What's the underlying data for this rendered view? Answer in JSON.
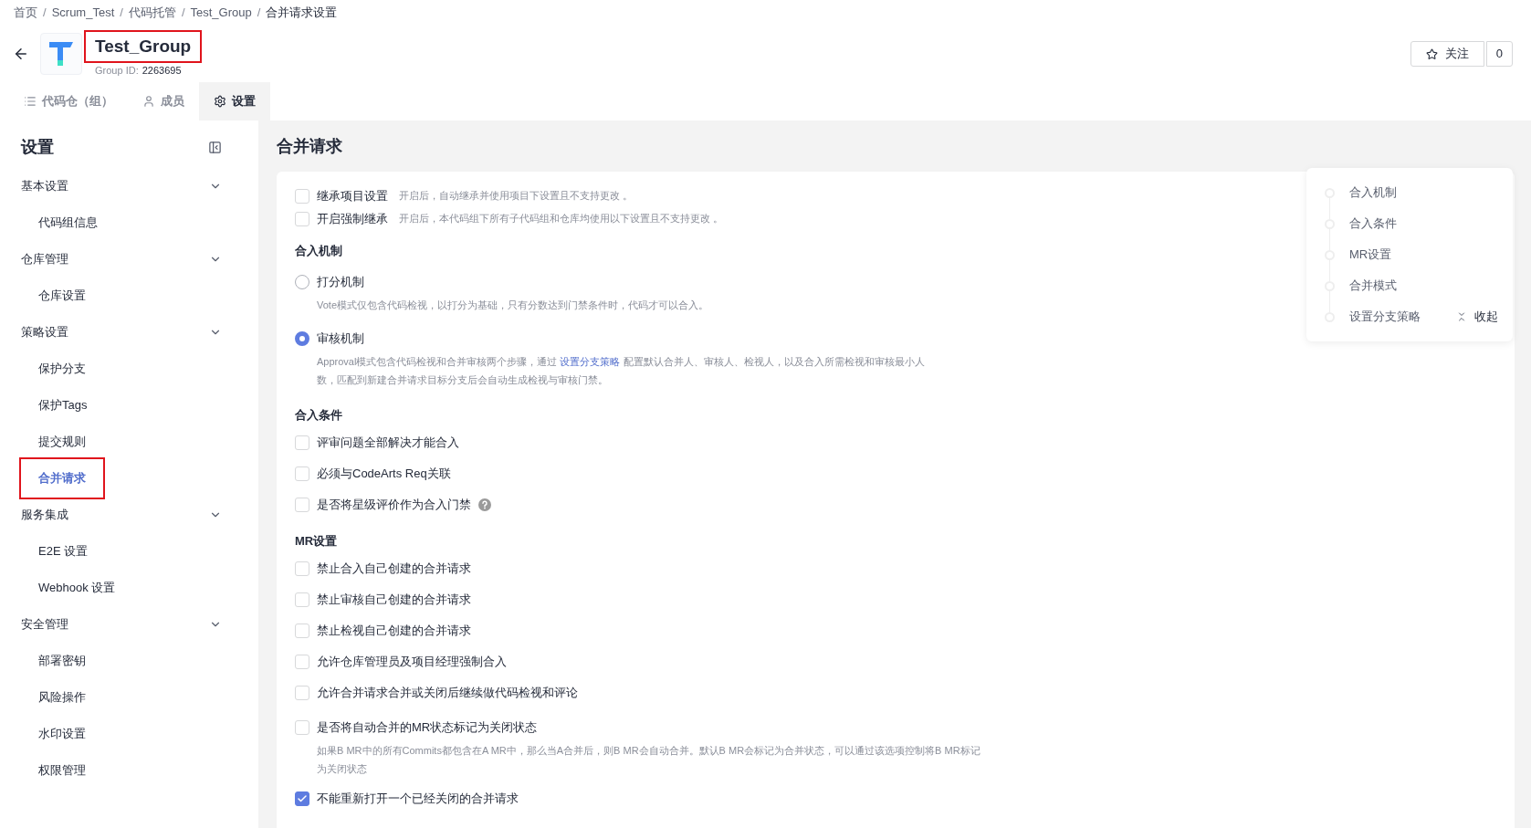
{
  "breadcrumb": [
    "首页",
    "Scrum_Test",
    "代码托管",
    "Test_Group",
    "合并请求设置"
  ],
  "breadcrumb_separator": "/",
  "header": {
    "title": "Test_Group",
    "highlighted": true,
    "group_id_label": "Group ID:",
    "group_id": "2263695"
  },
  "follow": {
    "label": "关注",
    "count": "0"
  },
  "tabs": [
    {
      "label": "代码仓（组）",
      "selected": false
    },
    {
      "label": "成员",
      "selected": false
    },
    {
      "label": "设置",
      "selected": true
    }
  ],
  "sidebar": {
    "title": "设置",
    "groups": [
      {
        "label": "基本设置",
        "expanded": true,
        "children": [
          {
            "label": "代码组信息",
            "selected": false,
            "highlighted": false
          }
        ]
      },
      {
        "label": "仓库管理",
        "expanded": true,
        "children": [
          {
            "label": "仓库设置",
            "selected": false,
            "highlighted": false
          }
        ]
      },
      {
        "label": "策略设置",
        "expanded": true,
        "children": [
          {
            "label": "保护分支",
            "selected": false,
            "highlighted": false
          },
          {
            "label": "保护Tags",
            "selected": false,
            "highlighted": false
          },
          {
            "label": "提交规则",
            "selected": false,
            "highlighted": false
          },
          {
            "label": "合并请求",
            "selected": true,
            "highlighted": true
          }
        ]
      },
      {
        "label": "服务集成",
        "expanded": true,
        "children": [
          {
            "label": "E2E 设置",
            "selected": false,
            "highlighted": false
          },
          {
            "label": "Webhook 设置",
            "selected": false,
            "highlighted": false
          }
        ]
      },
      {
        "label": "安全管理",
        "expanded": true,
        "children": [
          {
            "label": "部署密钥",
            "selected": false,
            "highlighted": false
          },
          {
            "label": "风险操作",
            "selected": false,
            "highlighted": false
          },
          {
            "label": "水印设置",
            "selected": false,
            "highlighted": false
          },
          {
            "label": "权限管理",
            "selected": false,
            "highlighted": false
          }
        ]
      }
    ]
  },
  "page_title": "合并请求",
  "inherit_options": [
    {
      "label": "继承项目设置",
      "hint": "开启后，自动继承并使用项目下设置且不支持更改 。",
      "checked": false
    },
    {
      "label": "开启强制继承",
      "hint": "开启后，本代码组下所有子代码组和仓库均使用以下设置且不支持更改 。",
      "checked": false
    }
  ],
  "sections": [
    {
      "title": "合入机制",
      "items": [
        {
          "kind": "radio",
          "label": "打分机制",
          "selected": false,
          "description": "Vote模式仅包含代码检视，以打分为基础，只有分数达到门禁条件时，代码才可以合入。"
        },
        {
          "kind": "radio",
          "label": "审核机制",
          "selected": true,
          "description_before": "Approval模式包含代码检视和合并审核两个步骤，通过 ",
          "link": "设置分支策略",
          "description_after": " 配置默认合并人、审核人、检视人，以及合入所需检视和审核最小人数，匹配到新建合并请求目标分支后会自动生成检视与审核门禁。"
        }
      ]
    },
    {
      "title": "合入条件",
      "items": [
        {
          "kind": "checkbox",
          "label": "评审问题全部解决才能合入",
          "checked": false
        },
        {
          "kind": "checkbox",
          "label": "必须与CodeArts Req关联",
          "checked": false
        },
        {
          "kind": "checkbox",
          "label": "是否将星级评价作为合入门禁",
          "checked": false,
          "help": true
        }
      ]
    },
    {
      "title": "MR设置",
      "items": [
        {
          "kind": "checkbox",
          "label": "禁止合入自己创建的合并请求",
          "checked": false
        },
        {
          "kind": "checkbox",
          "label": "禁止审核自己创建的合并请求",
          "checked": false
        },
        {
          "kind": "checkbox",
          "label": "禁止检视自己创建的合并请求",
          "checked": false
        },
        {
          "kind": "checkbox",
          "label": "允许仓库管理员及项目经理强制合入",
          "checked": false
        },
        {
          "kind": "checkbox",
          "label": "允许合并请求合并或关闭后继续做代码检视和评论",
          "checked": false
        },
        {
          "kind": "checkbox",
          "label": "是否将自动合并的MR状态标记为关闭状态",
          "checked": false,
          "description": "如果B MR中的所有Commits都包含在A MR中，那么当A合并后，则B MR会自动合并。默认B MR会标记为合并状态，可以通过该选项控制将B MR标记为关闭状态"
        },
        {
          "kind": "checkbox",
          "label": "不能重新打开一个已经关闭的合并请求",
          "checked": true
        }
      ]
    }
  ],
  "toc": {
    "items": [
      "合入机制",
      "合入条件",
      "MR设置",
      "合并模式",
      "设置分支策略"
    ],
    "collapse_label": "收起"
  }
}
